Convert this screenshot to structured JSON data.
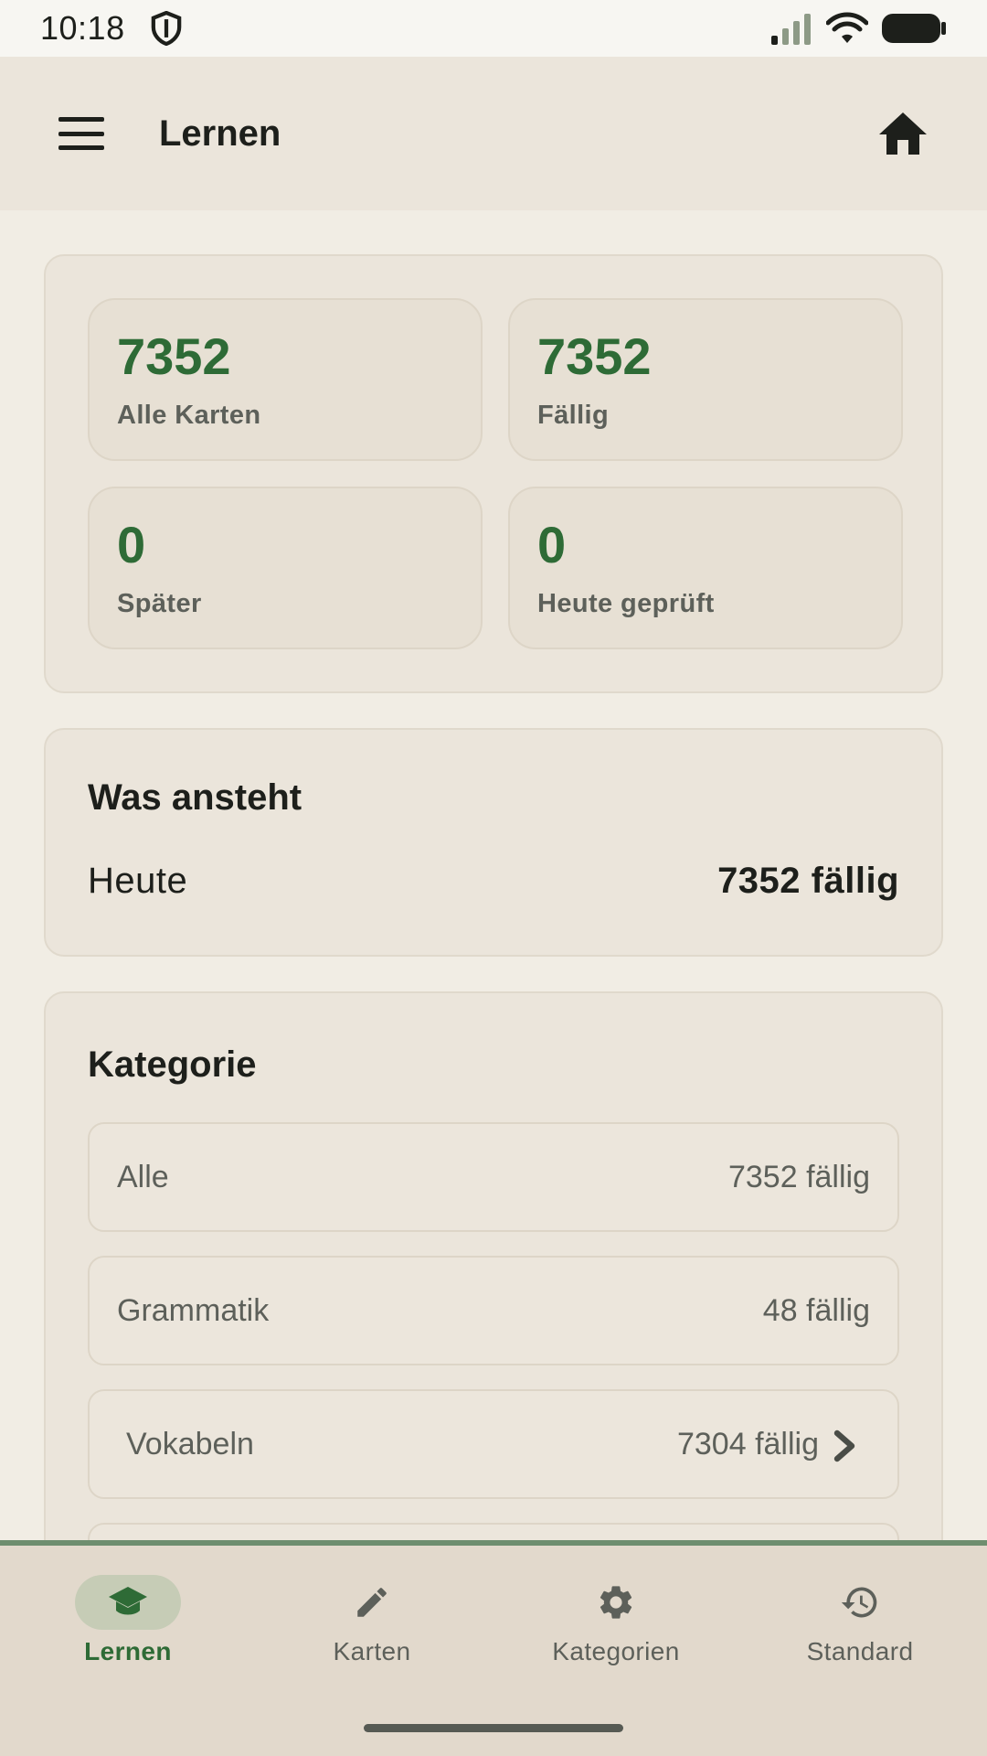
{
  "status_bar": {
    "time": "10:18",
    "icons": [
      "shield-icon",
      "signal-icon",
      "wifi-icon",
      "battery-icon"
    ]
  },
  "app_bar": {
    "title": "Lernen",
    "icons": [
      "menu-icon",
      "home-icon"
    ]
  },
  "stats": [
    {
      "value": "7352",
      "label": "Alle Karten"
    },
    {
      "value": "7352",
      "label": "Fällig"
    },
    {
      "value": "0",
      "label": "Später"
    },
    {
      "value": "0",
      "label": "Heute geprüft"
    }
  ],
  "upcoming": {
    "title": "Was ansteht",
    "label": "Heute",
    "value": "7352 fällig"
  },
  "categories": {
    "title": "Kategorie",
    "items": [
      {
        "name": "Alle",
        "count": "7352 fällig"
      },
      {
        "name": "Grammatik",
        "count": "48 fällig"
      },
      {
        "name": "Vokabeln",
        "count": "7304 fällig"
      }
    ]
  },
  "bottom_nav": {
    "items": [
      {
        "label": "Lernen",
        "icon": "school-icon",
        "active": true
      },
      {
        "label": "Karten",
        "icon": "pencil-icon",
        "active": false
      },
      {
        "label": "Kategorien",
        "icon": "gear-icon",
        "active": false
      },
      {
        "label": "Standard",
        "icon": "history-icon",
        "active": false
      }
    ]
  },
  "colors": {
    "accent": "#2e6b36",
    "surface": "#ebe5db",
    "background": "#f1ede4",
    "nav_background": "#e2d9cc"
  }
}
